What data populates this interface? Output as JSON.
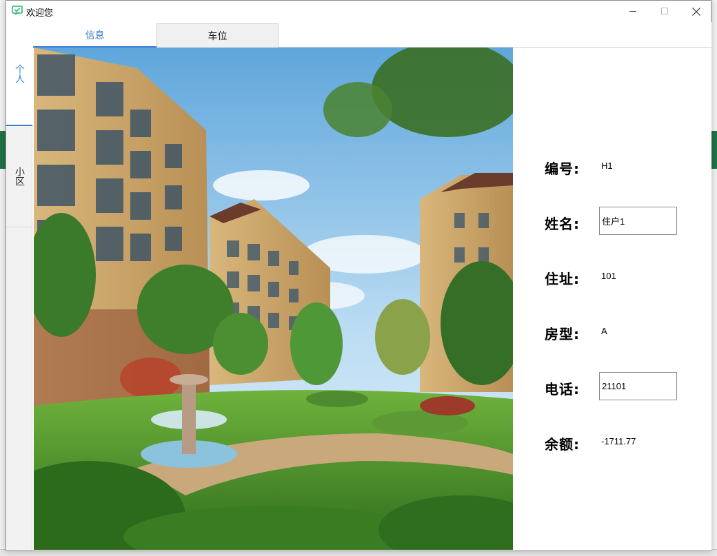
{
  "window": {
    "title": "欢迎您"
  },
  "window_controls": {
    "minimize": "—",
    "maximize": "☐",
    "close": "✕"
  },
  "sidebar": {
    "tabs": [
      {
        "label": "个人"
      },
      {
        "label": "小区"
      }
    ]
  },
  "tabs": [
    {
      "label": "信息"
    },
    {
      "label": "车位"
    }
  ],
  "info": {
    "id_label": "编号:",
    "id_value": "H1",
    "name_label": "姓名:",
    "name_value": "住户1",
    "address_label": "住址:",
    "address_value": "101",
    "type_label": "房型:",
    "type_value": "A",
    "phone_label": "电话:",
    "phone_value": "21101",
    "balance_label": "余额:",
    "balance_value": "-1711.77"
  },
  "colors": {
    "accent": "#3b7fd4",
    "brand_icon": "#2bb673",
    "sky": "#7db9e8"
  },
  "icons": {
    "app": "chat-check-icon"
  }
}
